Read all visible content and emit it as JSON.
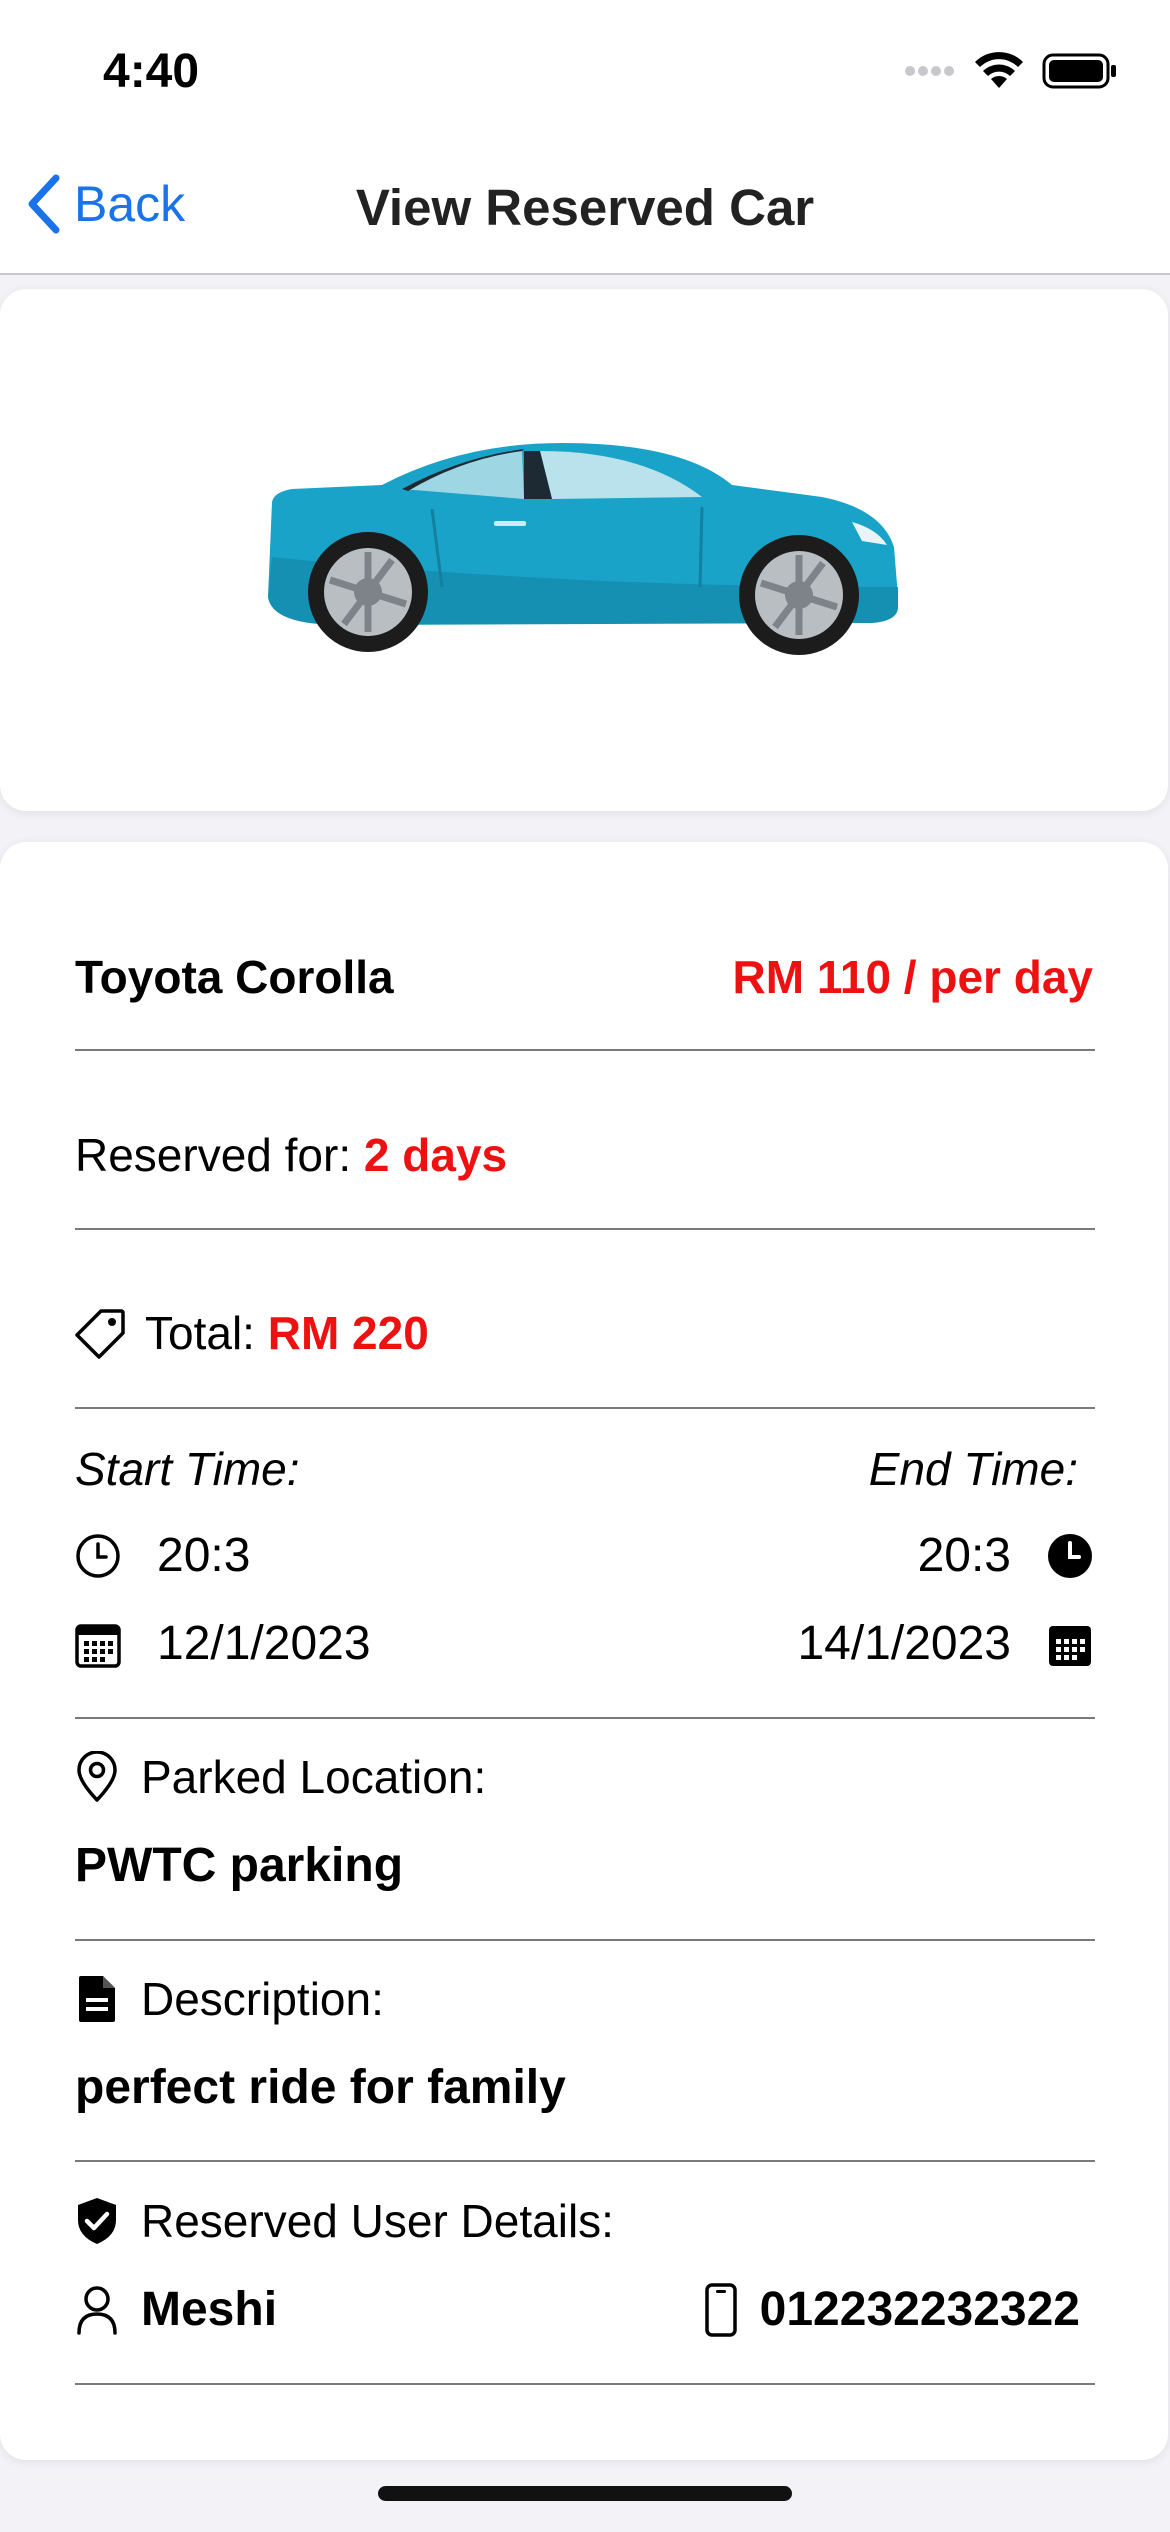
{
  "status_bar": {
    "time": "4:40"
  },
  "nav": {
    "back_label": "Back",
    "title": "View Reserved Car"
  },
  "car": {
    "name": "Toyota Corolla",
    "price": "RM 110 / per day",
    "color": "#1aa3c8"
  },
  "reservation": {
    "reserved_for_label": "Reserved for:",
    "reserved_for_value": "2 days",
    "total_label": "Total:",
    "total_value": "RM 220"
  },
  "times": {
    "start_label": "Start Time:",
    "end_label": "End Time:",
    "start_time": "20:3",
    "end_time": "20:3",
    "start_date": "12/1/2023",
    "end_date": "14/1/2023"
  },
  "location": {
    "label": "Parked Location:",
    "value": "PWTC parking"
  },
  "description": {
    "label": "Description:",
    "value": "perfect ride for family"
  },
  "user": {
    "label": "Reserved User Details:",
    "name": "Meshi",
    "phone": "012232232322"
  },
  "colors": {
    "accent_blue": "#1a73e8",
    "highlight_red": "#ee1111"
  },
  "icons": [
    "chevron-left-icon",
    "tag-icon",
    "clock-outline-icon",
    "clock-filled-icon",
    "calendar-outline-icon",
    "calendar-filled-icon",
    "location-pin-icon",
    "document-icon",
    "shield-check-icon",
    "person-icon",
    "phone-icon"
  ]
}
